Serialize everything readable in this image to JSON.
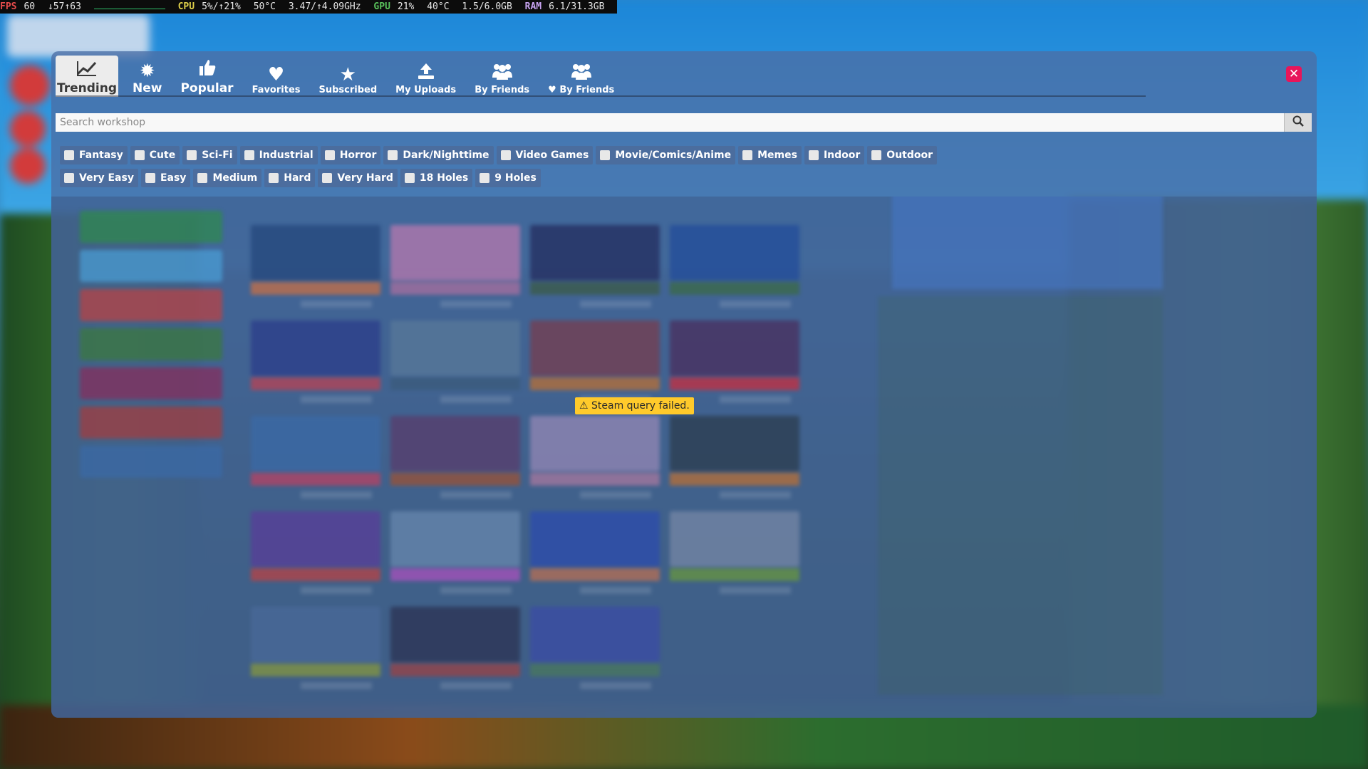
{
  "osd": {
    "fps_label": "FPS",
    "fps_value": "60",
    "frametime": "↓57↑63",
    "cpu_label": "CPU",
    "cpu_value": "5%/↑21%",
    "cpu_temp": "50°C",
    "cpu_clock": "3.47/↑4.09GHz",
    "gpu_label": "GPU",
    "gpu_value": "21%",
    "gpu_temp": "40°C",
    "vram": "1.5/6.0GB",
    "ram_label": "RAM",
    "ram_value": "6.1/31.3GB"
  },
  "tabs": [
    {
      "label": "Trending",
      "icon": "trending-chart-icon"
    },
    {
      "label": "New",
      "icon": "starburst-icon"
    },
    {
      "label": "Popular",
      "icon": "thumbs-up-icon"
    },
    {
      "label": "Favorites",
      "icon": "heart-icon"
    },
    {
      "label": "Subscribed",
      "icon": "star-icon"
    },
    {
      "label": "My Uploads",
      "icon": "upload-icon"
    },
    {
      "label": "By Friends",
      "icon": "users-icon"
    },
    {
      "label": "♥ By Friends",
      "icon": "users-icon"
    }
  ],
  "search": {
    "placeholder": "Search workshop"
  },
  "filters": {
    "themes": [
      "Fantasy",
      "Cute",
      "Sci-Fi",
      "Industrial",
      "Horror",
      "Dark/Nighttime",
      "Video Games",
      "Movie/Comics/Anime",
      "Memes",
      "Indoor",
      "Outdoor"
    ],
    "difficulty": [
      "Very Easy",
      "Easy",
      "Medium",
      "Hard",
      "Very Hard",
      "18 Holes",
      "9 Holes"
    ]
  },
  "toast": {
    "message": "Steam query failed."
  },
  "colors": {
    "panel": "#4c6ea5",
    "close": "#e8155a",
    "toast": "#ffca2b"
  }
}
